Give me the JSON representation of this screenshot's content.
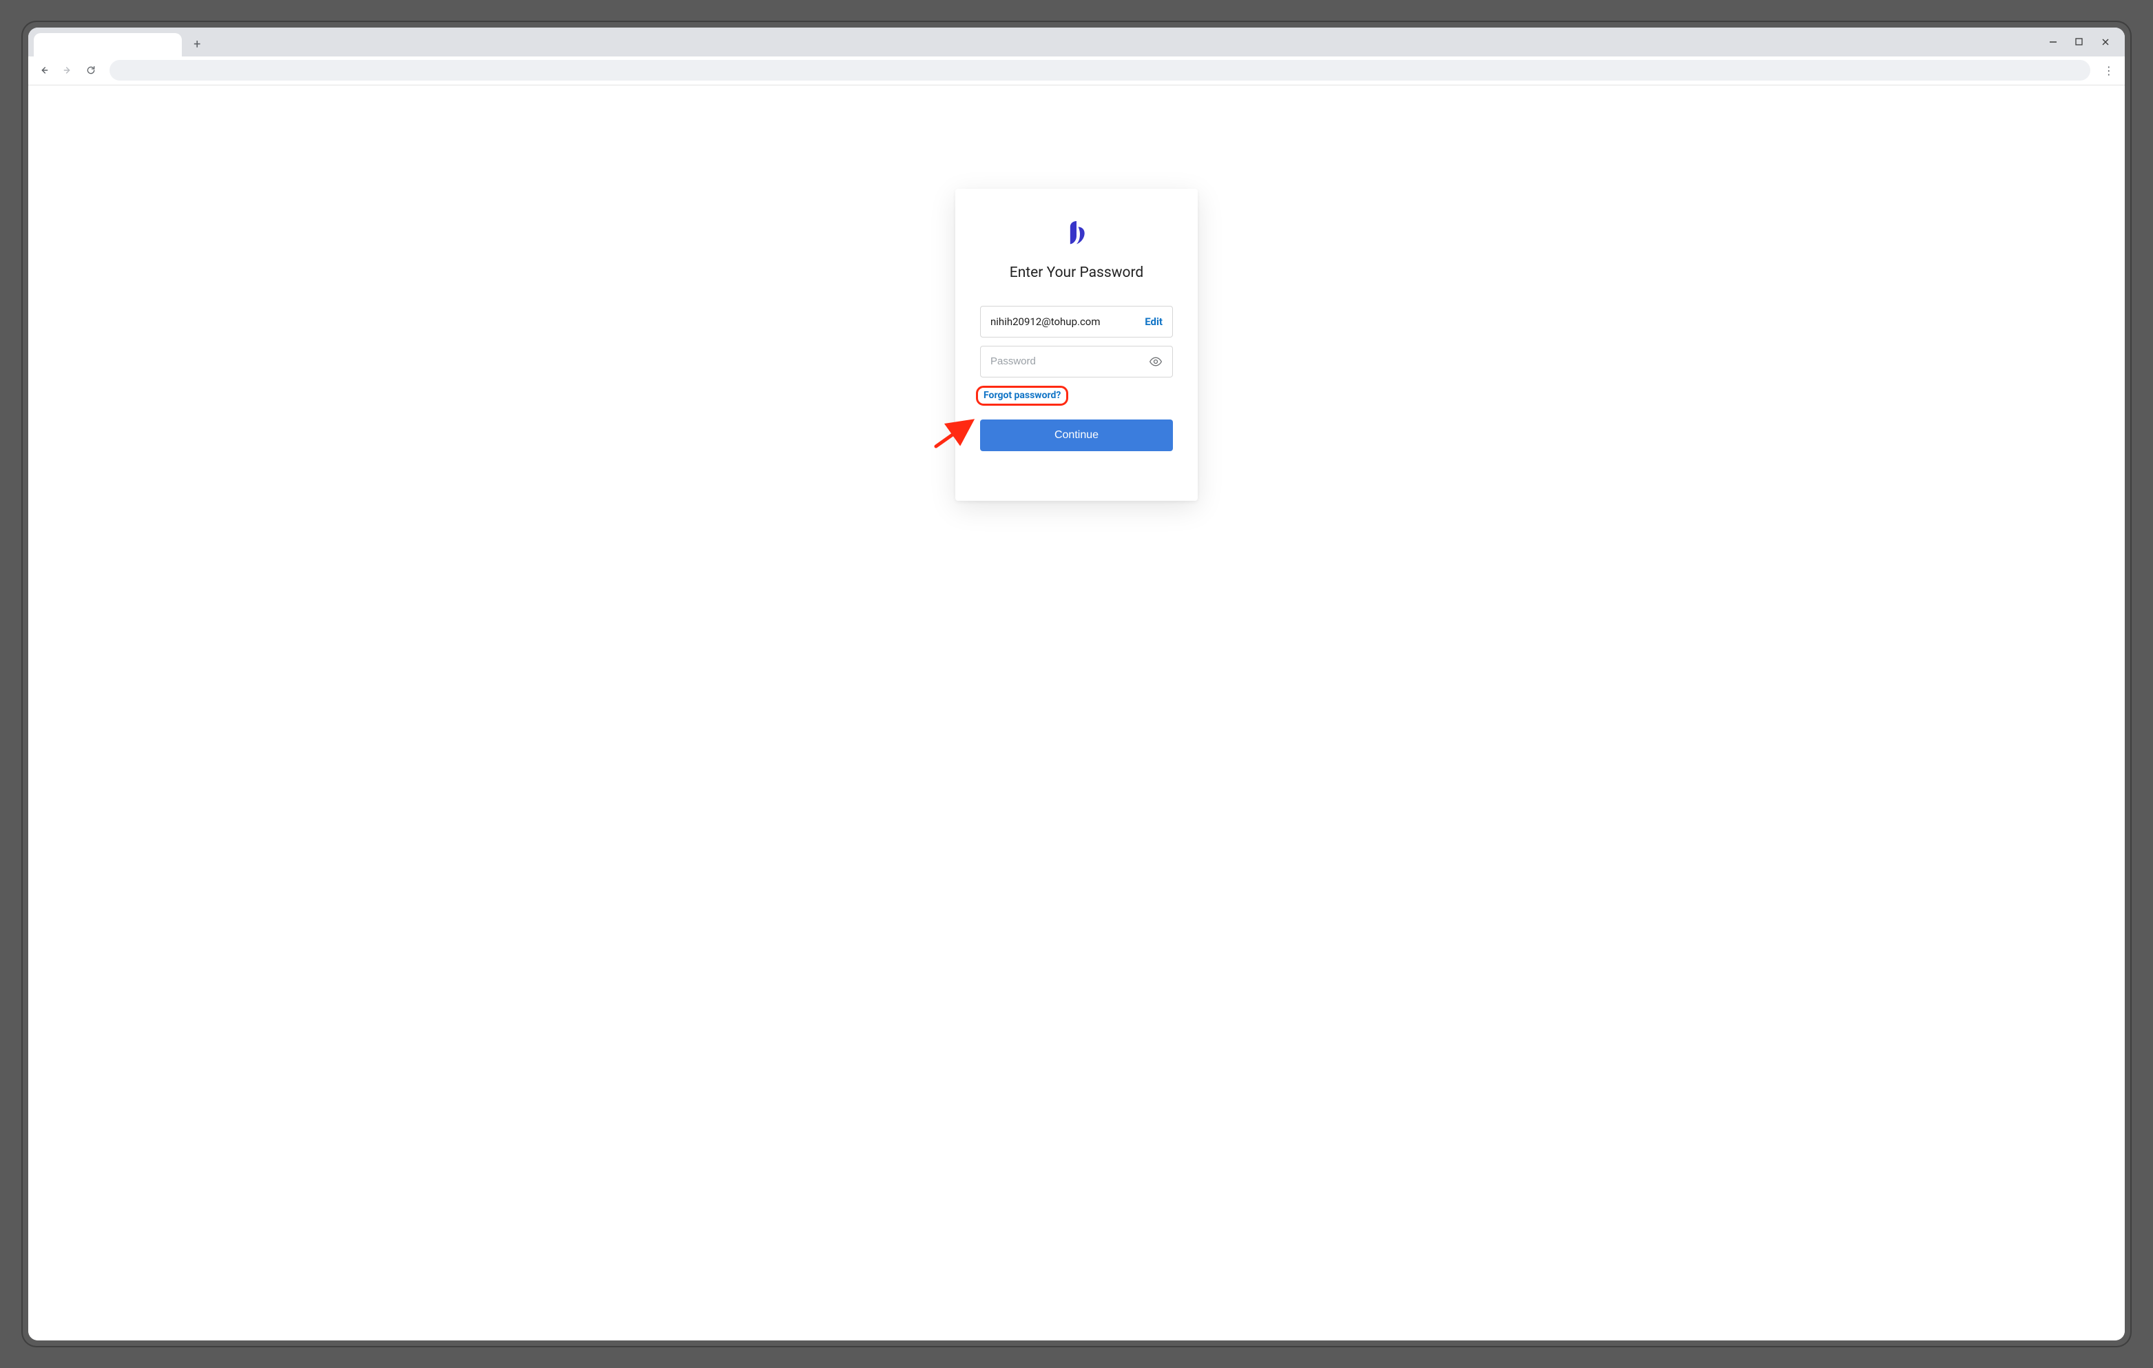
{
  "browser": {
    "new_tab_glyph": "+",
    "minimize_glyph": "–",
    "maximize_glyph": "□",
    "close_glyph": "✕",
    "kebab_glyph": "⋮"
  },
  "login": {
    "heading": "Enter Your Password",
    "email_value": "nihih20912@tohup.com",
    "edit_label": "Edit",
    "password_placeholder": "Password",
    "forgot_label": "Forgot password?",
    "continue_label": "Continue"
  },
  "colors": {
    "brand": "#3835c8",
    "link": "#1174c6",
    "primary_button": "#3b7ddd",
    "annotation": "#ff2a12"
  }
}
